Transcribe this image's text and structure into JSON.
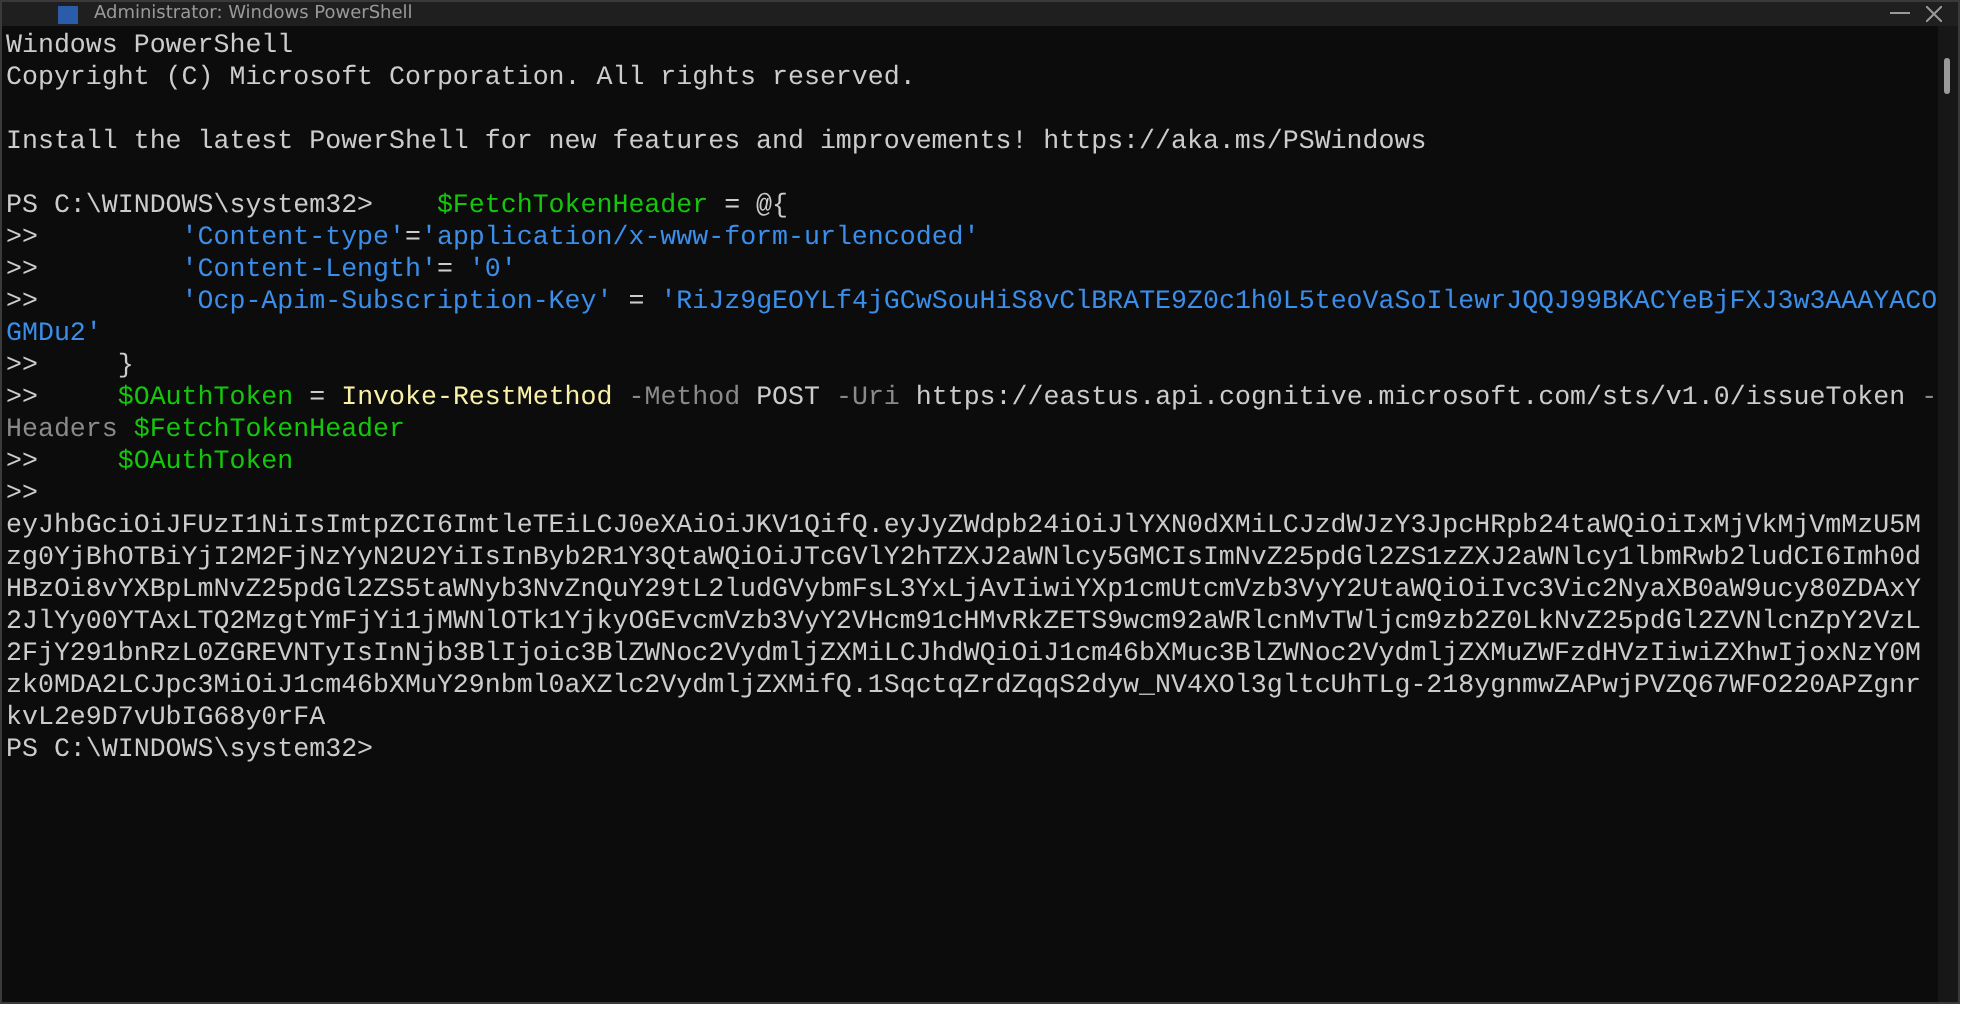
{
  "window": {
    "title": "Administrator: Windows PowerShell"
  },
  "lines": [
    {
      "kind": "text",
      "segments": [
        {
          "kind": "plain",
          "text": "Windows PowerShell"
        }
      ]
    },
    {
      "kind": "text",
      "segments": [
        {
          "kind": "plain",
          "text": "Copyright (C) Microsoft Corporation. All rights reserved."
        }
      ]
    },
    {
      "kind": "blank"
    },
    {
      "kind": "text",
      "segments": [
        {
          "kind": "plain",
          "text": "Install the latest PowerShell for new features and improvements! https://aka.ms/PSWindows"
        }
      ]
    },
    {
      "kind": "blank"
    },
    {
      "kind": "text",
      "segments": [
        {
          "kind": "plain",
          "text": "PS C:\\WINDOWS\\system32>    "
        },
        {
          "kind": "variable",
          "text": "$FetchTokenHeader"
        },
        {
          "kind": "plain",
          "text": " = @{"
        }
      ]
    },
    {
      "kind": "text",
      "segments": [
        {
          "kind": "plain",
          "text": ">>         "
        },
        {
          "kind": "string",
          "text": "'Content-type'"
        },
        {
          "kind": "plain",
          "text": "="
        },
        {
          "kind": "string",
          "text": "'application/x-www-form-urlencoded'"
        }
      ]
    },
    {
      "kind": "text",
      "segments": [
        {
          "kind": "plain",
          "text": ">>         "
        },
        {
          "kind": "string",
          "text": "'Content-Length'"
        },
        {
          "kind": "plain",
          "text": "= "
        },
        {
          "kind": "string",
          "text": "'0'"
        }
      ]
    },
    {
      "kind": "text",
      "segments": [
        {
          "kind": "plain",
          "text": ">>         "
        },
        {
          "kind": "string",
          "text": "'Ocp-Apim-Subscription-Key'"
        },
        {
          "kind": "plain",
          "text": " = "
        },
        {
          "kind": "string",
          "text": "'RiJz9gEOYLf4jGCwSouHiS8vClBRATE9Z0c1h0L5teoVaSoIlewrJQQJ99BKACYeBjFXJ3w3AAAYACO"
        }
      ]
    },
    {
      "kind": "text",
      "segments": [
        {
          "kind": "string",
          "text": "GMDu2'"
        }
      ]
    },
    {
      "kind": "text",
      "segments": [
        {
          "kind": "plain",
          "text": ">>     }"
        }
      ]
    },
    {
      "kind": "text",
      "segments": [
        {
          "kind": "plain",
          "text": ">>     "
        },
        {
          "kind": "variable",
          "text": "$OAuthToken"
        },
        {
          "kind": "plain",
          "text": " = "
        },
        {
          "kind": "command",
          "text": "Invoke-RestMethod"
        },
        {
          "kind": "parameter",
          "text": " -Method"
        },
        {
          "kind": "plain",
          "text": " POST "
        },
        {
          "kind": "parameter",
          "text": "-Uri"
        },
        {
          "kind": "plain",
          "text": " https://eastus.api.cognitive.microsoft.com/sts/v1.0/issueToken "
        },
        {
          "kind": "parameter",
          "text": "-"
        }
      ]
    },
    {
      "kind": "text",
      "segments": [
        {
          "kind": "parameter",
          "text": "Headers"
        },
        {
          "kind": "variable",
          "text": " $FetchTokenHeader"
        }
      ]
    },
    {
      "kind": "text",
      "segments": [
        {
          "kind": "plain",
          "text": ">>     "
        },
        {
          "kind": "variable",
          "text": "$OAuthToken"
        }
      ]
    },
    {
      "kind": "text",
      "segments": [
        {
          "kind": "plain",
          "text": ">>"
        }
      ]
    },
    {
      "kind": "text",
      "segments": [
        {
          "kind": "plain",
          "text": "eyJhbGciOiJFUzI1NiIsImtpZCI6ImtleTEiLCJ0eXAiOiJKV1QifQ.eyJyZWdpb24iOiJlYXN0dXMiLCJzdWJzY3JpcHRpb24taWQiOiIxMjVkMjVmMzU5M"
        }
      ]
    },
    {
      "kind": "text",
      "segments": [
        {
          "kind": "plain",
          "text": "zg0YjBhOTBiYjI2M2FjNzYyN2U2YiIsInByb2R1Y3QtaWQiOiJTcGVlY2hTZXJ2aWNlcy5GMCIsImNvZ25pdGl2ZS1zZXJ2aWNlcy1lbmRwb2ludCI6Imh0d"
        }
      ]
    },
    {
      "kind": "text",
      "segments": [
        {
          "kind": "plain",
          "text": "HBzOi8vYXBpLmNvZ25pdGl2ZS5taWNyb3NvZnQuY29tL2ludGVybmFsL3YxLjAvIiwiYXp1cmUtcmVzb3VyY2UtaWQiOiIvc3Vic2NyaXB0aW9ucy80ZDAxY"
        }
      ]
    },
    {
      "kind": "text",
      "segments": [
        {
          "kind": "plain",
          "text": "2JlYy00YTAxLTQ2MzgtYmFjYi1jMWNlOTk1YjkyOGEvcmVzb3VyY2VHcm91cHMvRkZETS9wcm92aWRlcnMvTWljcm9zb2Z0LkNvZ25pdGl2ZVNlcnZpY2VzL"
        }
      ]
    },
    {
      "kind": "text",
      "segments": [
        {
          "kind": "plain",
          "text": "2FjY291bnRzL0ZGREVNTyIsInNjb3BlIjoic3BlZWNoc2VydmljZXMiLCJhdWQiOiJ1cm46bXMuc3BlZWNoc2VydmljZXMuZWFzdHVzIiwiZXhwIjoxNzY0M"
        }
      ]
    },
    {
      "kind": "text",
      "segments": [
        {
          "kind": "plain",
          "text": "zk0MDA2LCJpc3MiOiJ1cm46bXMuY29nbml0aXZlc2VydmljZXMifQ.1SqctqZrdZqqS2dyw_NV4XOl3gltcUhTLg-218ygnmwZAPwjPVZQ67WFO220APZgnr"
        }
      ]
    },
    {
      "kind": "text",
      "segments": [
        {
          "kind": "plain",
          "text": "kvL2e9D7vUbIG68y0rFA"
        }
      ]
    },
    {
      "kind": "text",
      "segments": [
        {
          "kind": "plain",
          "text": "PS C:\\WINDOWS\\system32>"
        }
      ]
    }
  ]
}
